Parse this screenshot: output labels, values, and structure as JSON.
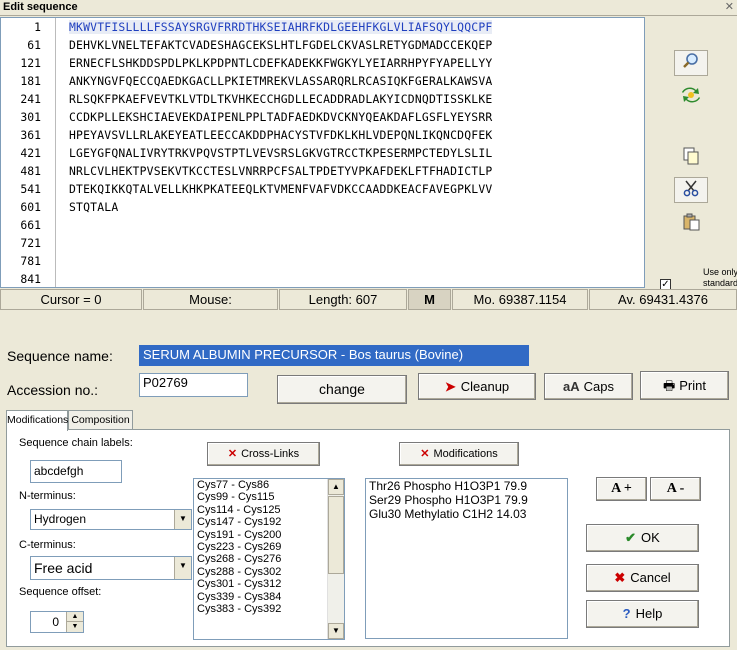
{
  "window": {
    "title": "Edit sequence",
    "close_label": "✕"
  },
  "sequence": {
    "lines": [
      {
        "num": "1",
        "seq": "MKWVTFISLLLLFSSAYSRGVFRRDTHKSEIAHRFKDLGEEHFKGLVLIAFSQYLQQCPF"
      },
      {
        "num": "61",
        "seq": "DEHVKLVNELTEFAKTCVADESHAGCEKSLHTLFGDELCKVASLRETYGDMADCCEKQEP"
      },
      {
        "num": "121",
        "seq": "ERNECFLSHKDDSPDLPKLKPDPNTLCDEFKADEKKFWGKYLYEIARRHPYFYAPELLYY"
      },
      {
        "num": "181",
        "seq": "ANKYNGVFQECCQAEDKGACLLPKIETMREKVLASSARQRLRCASIQKFGERALKAWSVA"
      },
      {
        "num": "241",
        "seq": "RLSQKFPKAEFVEVTKLVTDLTKVHKECCHGDLLECADDRADLAKYICDNQDTISSKLKE"
      },
      {
        "num": "301",
        "seq": "CCDKPLLEKSHCIAEVEKDAIPENLPPLTADFAEDKDVCKNYQEAKDAFLGSFLYEYSRR"
      },
      {
        "num": "361",
        "seq": "HPEYAVSVLLRLAKEYEATLEECCAKDDPHACYSTVFDKLKHLVDEPQNLIKQNCDQFEK"
      },
      {
        "num": "421",
        "seq": "LGEYGFQNALIVRYTRKVPQVSTPTLVEVSRSLGKVGTRCCTKPESERMPCTEDYLSLIL"
      },
      {
        "num": "481",
        "seq": "NRLCVLHEKTPVSEKVTKCCTESLVNRRPCFSALTPDETYVPKAFDEKLFTFHADICTLP"
      },
      {
        "num": "541",
        "seq": "DTEKQIKKQTALVELLKHKPKATEEQLKTVMENFVAFVDKCCAADDKEACFAVEGPKLVV"
      },
      {
        "num": "601",
        "seq": "STQTALA"
      },
      {
        "num": "661",
        "seq": ""
      },
      {
        "num": "721",
        "seq": ""
      },
      {
        "num": "781",
        "seq": ""
      },
      {
        "num": "841",
        "seq": ""
      }
    ]
  },
  "side": {
    "use_only_label": "Use only standard residues",
    "use_only_checked": "✓"
  },
  "status": {
    "cursor": "Cursor = 0",
    "mouse": "Mouse:",
    "length": "Length: 607",
    "m": "M",
    "mono": "Mo. 69387.1154",
    "avg": "Av. 69431.4376"
  },
  "form": {
    "name_label": "Sequence name:",
    "name_value": "SERUM ALBUMIN PRECURSOR - Bos taurus (Bovine)",
    "accession_label": "Accession no.:",
    "accession_value": "P02769",
    "change": "change",
    "cleanup": "Cleanup",
    "caps": "Caps",
    "print": "Print"
  },
  "tabs": {
    "modifications": "Modifications",
    "composition": "Composition"
  },
  "mods": {
    "chain_labels_label": "Sequence chain labels:",
    "chain_labels_value": "abcdefgh",
    "nterm_label": "N-terminus:",
    "nterm_value": "Hydrogen",
    "cterm_label": "C-terminus:",
    "cterm_value": "Free acid",
    "offset_label": "Sequence offset:",
    "offset_value": "0",
    "crosslinks_btn": "Cross-Links",
    "modifications_btn": "Modifications",
    "crosslinks": [
      "Cys77 - Cys86",
      "Cys99 - Cys115",
      "Cys114 - Cys125",
      "Cys147 - Cys192",
      "Cys191 - Cys200",
      "Cys223 - Cys269",
      "Cys268 - Cys276",
      "Cys288 - Cys302",
      "Cys301 - Cys312",
      "Cys339 - Cys384",
      "Cys383 - Cys392"
    ],
    "modifications": [
      "Thr26 Phospho H1O3P1 79.9",
      "Ser29 Phospho H1O3P1 79.9",
      "Glu30 Methylatio C1H2 14.03"
    ],
    "a_plus": "A +",
    "a_minus": "A -",
    "ok": "OK",
    "cancel": "Cancel",
    "help": "Help"
  }
}
